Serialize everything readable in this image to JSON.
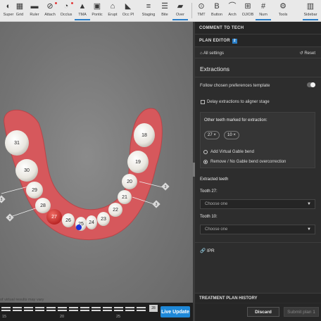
{
  "toolbar": {
    "tools": [
      {
        "label": "Super",
        "icon": "super-icon",
        "glyph": "◐"
      },
      {
        "label": "Grid",
        "icon": "grid-icon",
        "glyph": "▦"
      },
      {
        "label": "Ruler",
        "icon": "ruler-icon",
        "glyph": "▬"
      },
      {
        "label": "Attach",
        "icon": "attach-icon",
        "glyph": "⊘"
      },
      {
        "label": "Occlus",
        "icon": "occlusion-icon",
        "glyph": "◔"
      },
      {
        "label": "TMA",
        "icon": "tma-icon",
        "glyph": "▲"
      },
      {
        "label": "Pontic",
        "icon": "pontic-icon",
        "glyph": "▣"
      },
      {
        "label": "Erupt",
        "icon": "erupt-icon",
        "glyph": "⌂"
      },
      {
        "label": "Occ Pl",
        "icon": "occlusal-plane-icon",
        "glyph": "◣"
      },
      {
        "label": "Staging",
        "icon": "staging-icon",
        "glyph": "≡"
      },
      {
        "label": "Bite",
        "icon": "bite-icon",
        "glyph": "☰"
      },
      {
        "label": "Over",
        "icon": "overlay-icon",
        "glyph": "▰"
      },
      {
        "label": "TMT",
        "icon": "tmt-icon",
        "glyph": "⊙"
      },
      {
        "label": "Button",
        "icon": "button-icon",
        "glyph": "B"
      },
      {
        "label": "Arch",
        "icon": "arch-icon",
        "glyph": "⌒"
      },
      {
        "label": "OJ/OB",
        "icon": "ojob-icon",
        "glyph": "⊞"
      },
      {
        "label": "Num",
        "icon": "numbering-icon",
        "glyph": "#"
      },
      {
        "label": "Tools",
        "icon": "gear-icon",
        "glyph": "⚙"
      },
      {
        "label": "Sidebar",
        "icon": "sidebar-icon",
        "glyph": "▥"
      }
    ]
  },
  "viewport": {
    "disclaimer": "of virtual results may vary",
    "teeth": [
      "18",
      "19",
      "20",
      "21",
      "22",
      "23",
      "24",
      "25",
      "26",
      "27",
      "28",
      "29",
      "30",
      "31"
    ],
    "selected_tooth": "27",
    "marker_labels": [
      "3",
      "3",
      "3",
      "3"
    ]
  },
  "stagebar": {
    "current_stage": "28",
    "tick_labels": [
      "15",
      "20",
      "25"
    ],
    "live_update": "Live Update"
  },
  "panel": {
    "comment_header": "COMMENT TO TECH",
    "plan_editor": "PLAN EDITOR",
    "plan_badge": "2",
    "all_settings": "All settings",
    "reset": "Reset",
    "section_title": "Extractions",
    "follow_template": "Follow chosen preferences template",
    "delay_extractions": "Delay extractions to aligner stage",
    "marked_title": "Other teeth marked for extraction:",
    "marked_teeth": [
      "27",
      "10"
    ],
    "option_add": "Add Virtual Gable bend",
    "option_remove": "Remove / No Gable bend overcorrection",
    "extracted_title": "Extracted teeth",
    "tooth27_label": "Tooth 27:",
    "tooth27_value": "Choose one",
    "tooth10_label": "Tooth 10:",
    "tooth10_value": "Choose one",
    "ipr": "IPR",
    "history": "TREATMENT PLAN HISTORY",
    "discard": "Discard",
    "submit": "Submit plan 1"
  },
  "colors": {
    "accent": "#1e88d8",
    "extract_tooth": "#d92b2b",
    "marker": "#1a2fd8",
    "gum": "#d9585a"
  }
}
